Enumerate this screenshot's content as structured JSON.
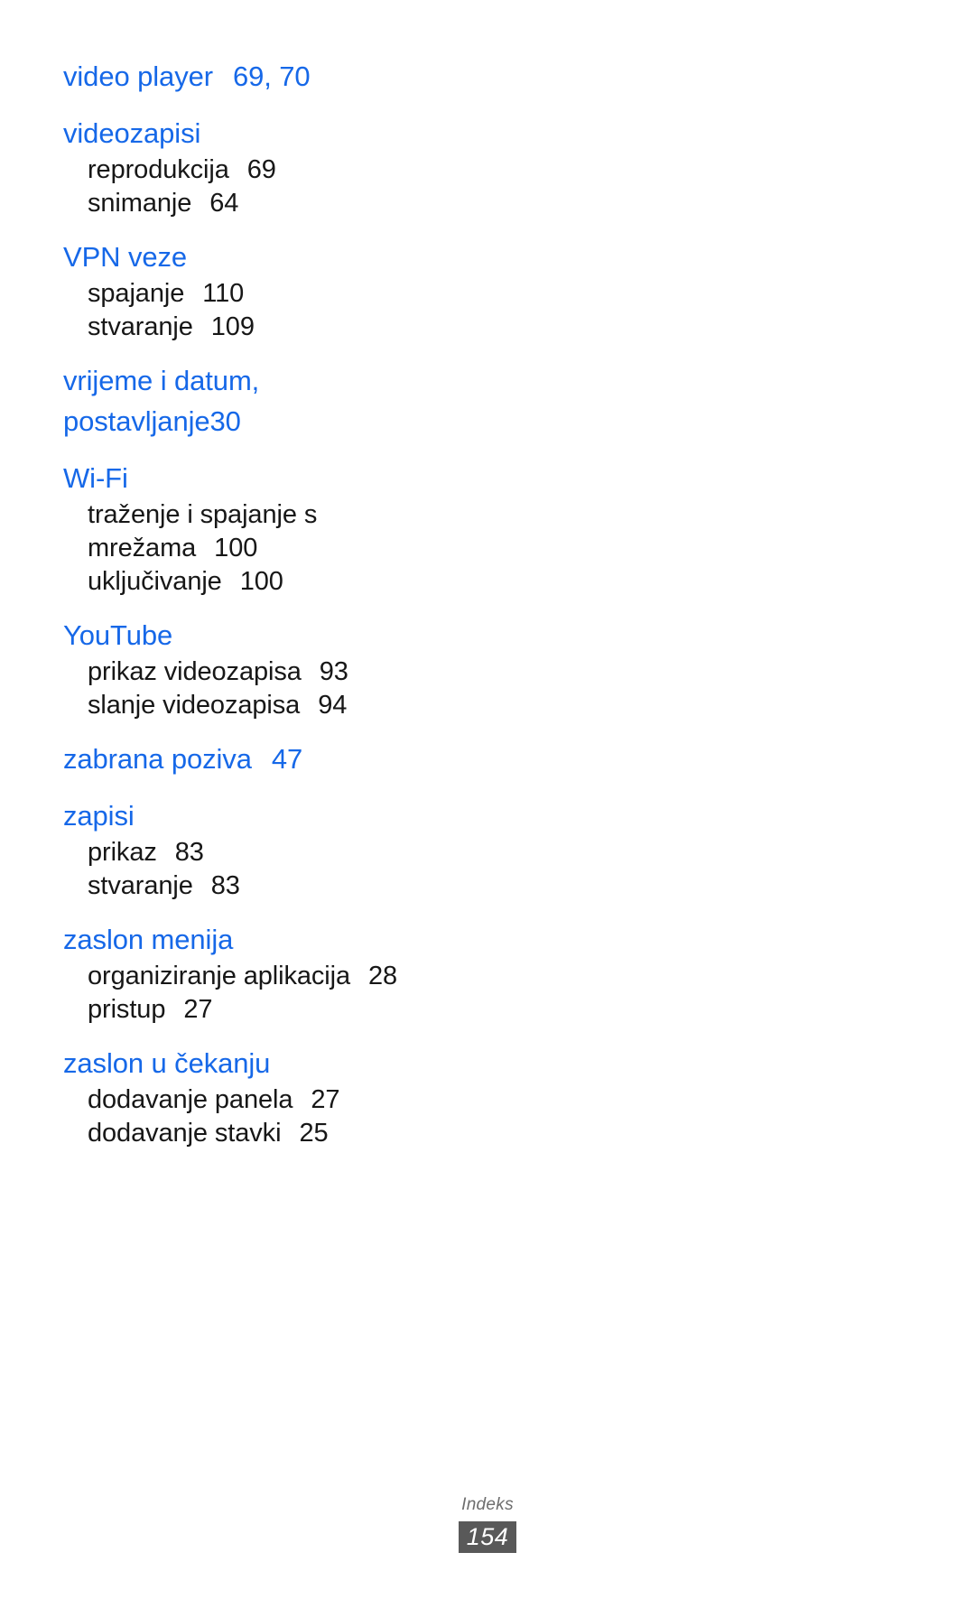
{
  "document": {
    "type": "index-page",
    "language": "hr",
    "heading_color": "#1668e8",
    "body_color": "#171717",
    "footer_box_color": "#595959"
  },
  "index": {
    "groups": [
      {
        "heading": "video player",
        "heading_pages": "69, 70",
        "entries": []
      },
      {
        "heading": "videozapisi",
        "heading_pages": "",
        "entries": [
          {
            "label": "reprodukcija",
            "page": "69"
          },
          {
            "label": "snimanje",
            "page": "64"
          }
        ]
      },
      {
        "heading": "VPN veze",
        "heading_pages": "",
        "entries": [
          {
            "label": "spajanje",
            "page": "110"
          },
          {
            "label": "stvaranje",
            "page": "109"
          }
        ]
      },
      {
        "heading": "vrijeme i datum,",
        "heading_line2": "postavljanje",
        "heading_pages": "30",
        "entries": []
      },
      {
        "heading": "Wi-Fi",
        "heading_pages": "",
        "entries": [
          {
            "label": "traženje i spajanje s",
            "page": "",
            "continuation": "mrežama",
            "continuation_page": "100"
          },
          {
            "label": "uključivanje",
            "page": "100"
          }
        ]
      },
      {
        "heading": "YouTube",
        "heading_pages": "",
        "entries": [
          {
            "label": "prikaz videozapisa",
            "page": "93"
          },
          {
            "label": "slanje videozapisa",
            "page": "94"
          }
        ]
      },
      {
        "heading": "zabrana poziva",
        "heading_pages": "47",
        "entries": []
      },
      {
        "heading": "zapisi",
        "heading_pages": "",
        "entries": [
          {
            "label": "prikaz",
            "page": "83"
          },
          {
            "label": "stvaranje",
            "page": "83"
          }
        ]
      },
      {
        "heading": "zaslon menija",
        "heading_pages": "",
        "entries": [
          {
            "label": "organiziranje aplikacija",
            "page": "28"
          },
          {
            "label": "pristup",
            "page": "27"
          }
        ]
      },
      {
        "heading": "zaslon u čekanju",
        "heading_pages": "",
        "entries": [
          {
            "label": "dodavanje panela",
            "page": "27"
          },
          {
            "label": "dodavanje stavki",
            "page": "25"
          }
        ]
      }
    ]
  },
  "footer": {
    "section_label": "Indeks",
    "page_number": "154"
  }
}
